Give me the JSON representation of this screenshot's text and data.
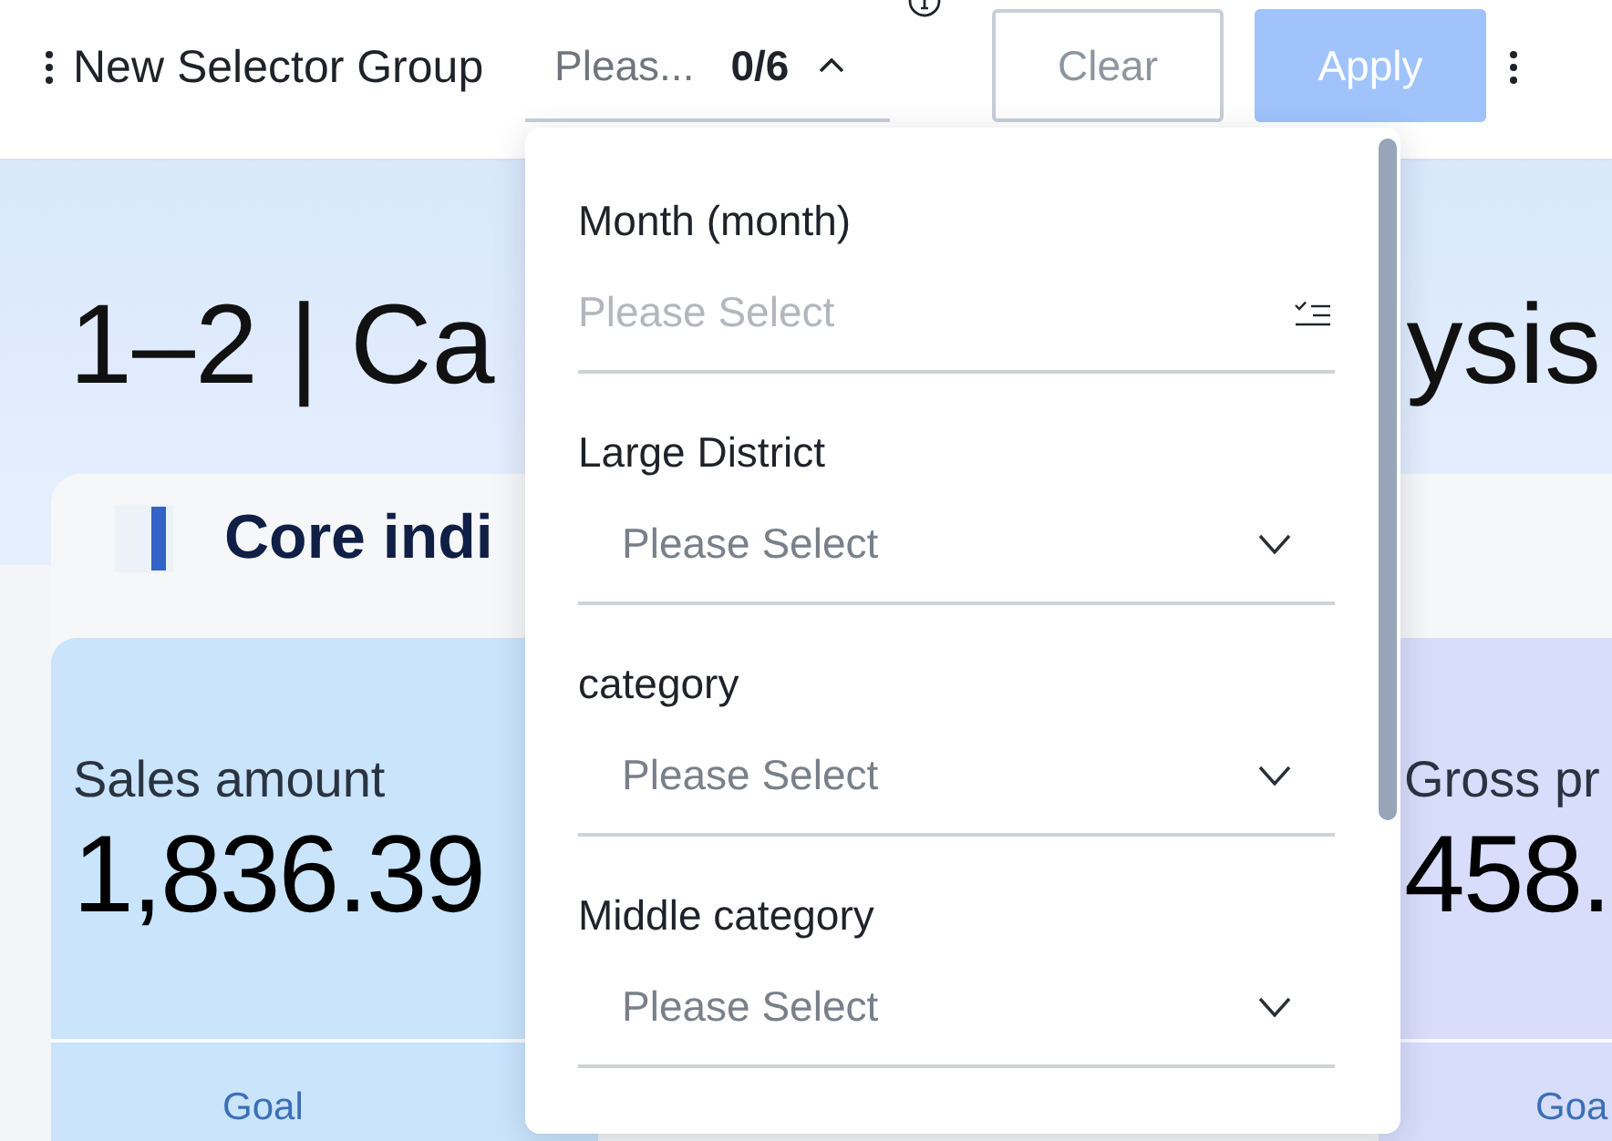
{
  "toolbar": {
    "title": "New Selector Group",
    "filter": {
      "placeholder": "Pleas...",
      "count": "0/6",
      "expanded": true
    },
    "buttons": [
      {
        "label": "Clear",
        "kind": "outline",
        "disabled": true
      },
      {
        "label": "Apply",
        "kind": "primary",
        "disabled": true
      }
    ]
  },
  "dashboard": {
    "title_visible_start": "1–2 | Ca",
    "title_visible_end": "ysis",
    "section": {
      "title": "Core indi"
    },
    "cards": [
      {
        "label": "Sales amount",
        "value": "1,836.39",
        "footer": "Goal",
        "color": "#c9e4fb"
      },
      {
        "label": "Gross pr",
        "value": "458.",
        "footer": "Goa",
        "color": "#d7ddfa"
      }
    ]
  },
  "dropdown": {
    "fields": [
      {
        "label": "Month (month)",
        "kind": "input",
        "placeholder": "Please Select"
      },
      {
        "label": "Large District",
        "kind": "select",
        "placeholder": "Please Select"
      },
      {
        "label": "category",
        "kind": "select",
        "placeholder": "Please Select"
      },
      {
        "label": "Middle category",
        "kind": "select",
        "placeholder": "Please Select"
      }
    ]
  }
}
